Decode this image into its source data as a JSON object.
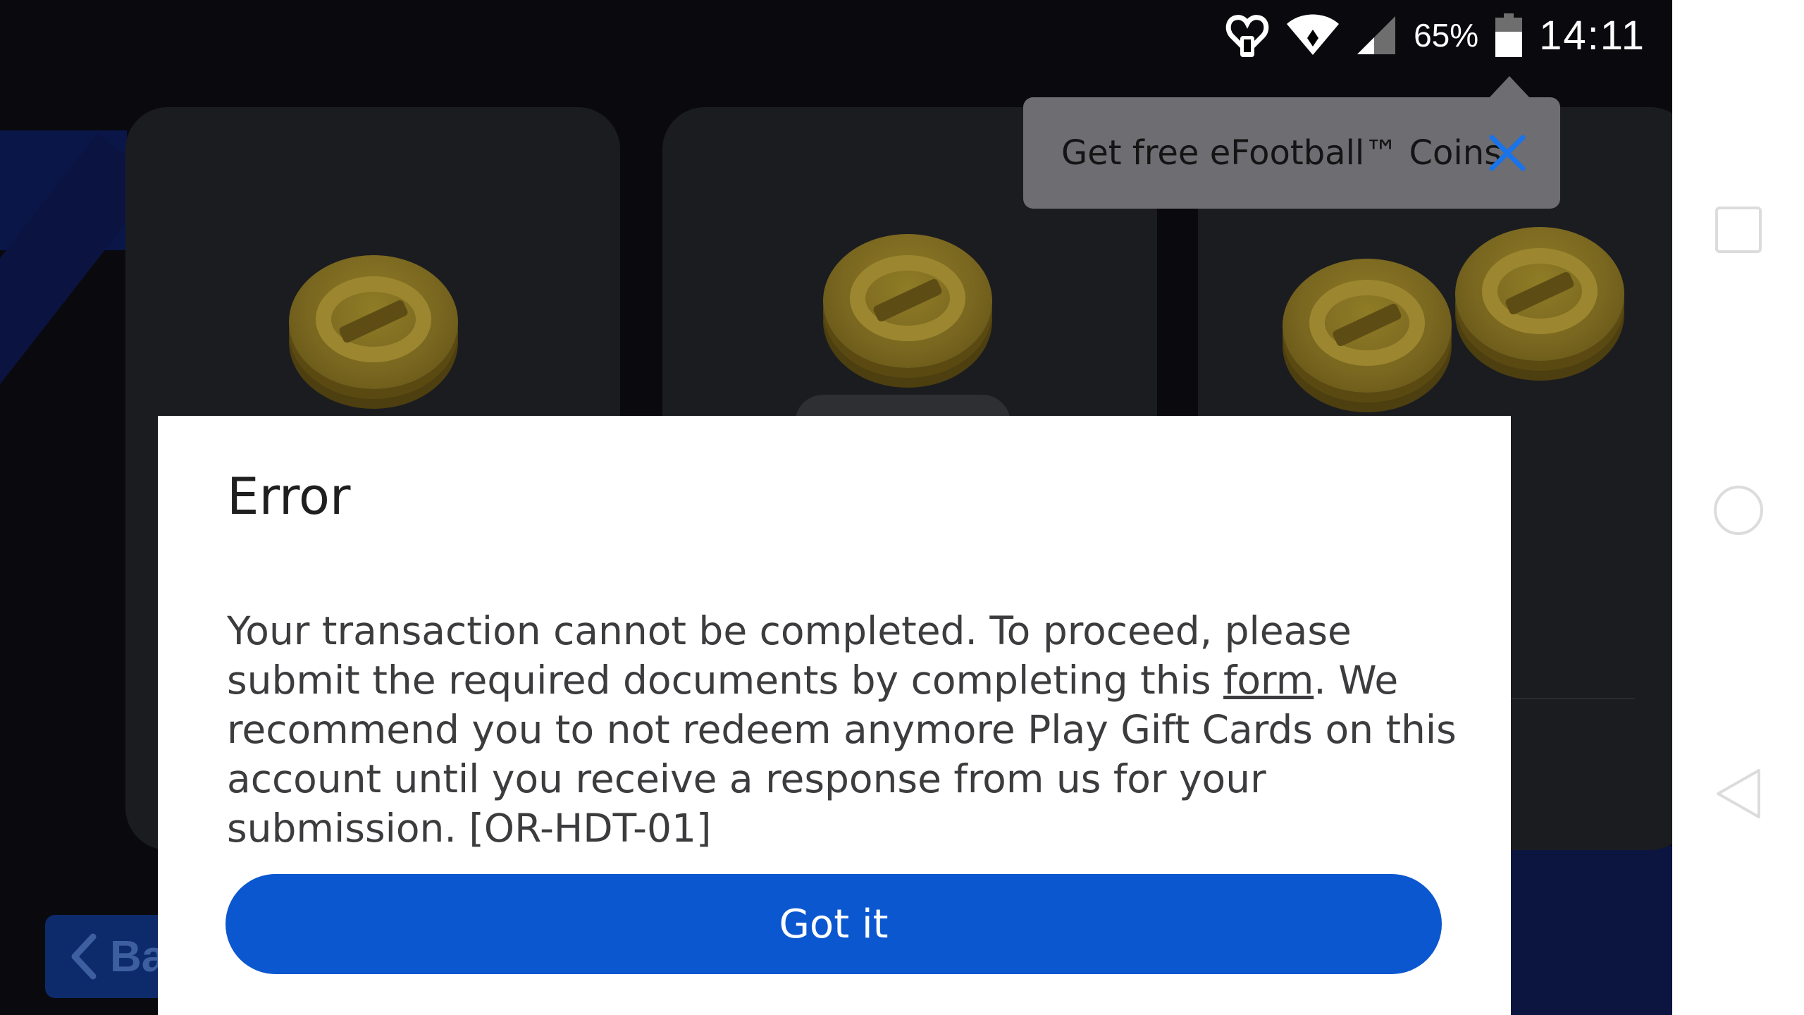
{
  "status_bar": {
    "battery": "65%",
    "time": "14:11"
  },
  "tooltip": {
    "text": "Get free eFootball™ Coins",
    "close_icon": "close-icon"
  },
  "background": {
    "back_button_label": "Ba"
  },
  "dialog": {
    "title": "Error",
    "body_before_link": "Your transaction cannot be completed. To proceed, please submit the required documents by completing this ",
    "link_text": "form",
    "body_after_link": ". We recommend you to not redeem anymore Play Gift Cards on this account until you receive a response from us for your submission. [OR-HDT-01]",
    "button_label": "Got it"
  },
  "nav_bar": {
    "recents_icon": "square-icon",
    "home_icon": "circle-icon",
    "back_icon": "triangle-back-icon"
  },
  "colors": {
    "primary_button": "#0b57d0",
    "tooltip_bg": "#6d6d72",
    "close_icon": "#1a73e8"
  }
}
